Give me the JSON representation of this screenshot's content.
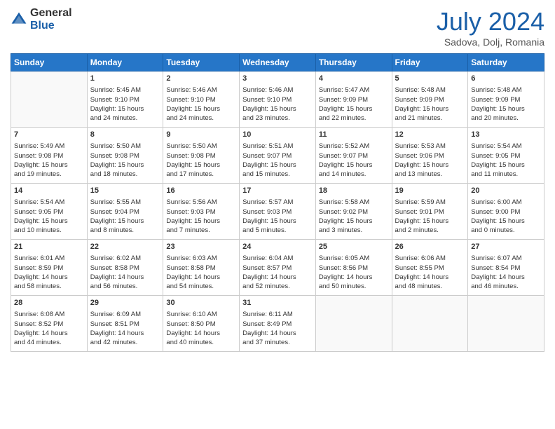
{
  "logo": {
    "general": "General",
    "blue": "Blue"
  },
  "title": "July 2024",
  "subtitle": "Sadova, Dolj, Romania",
  "days_header": [
    "Sunday",
    "Monday",
    "Tuesday",
    "Wednesday",
    "Thursday",
    "Friday",
    "Saturday"
  ],
  "weeks": [
    [
      {
        "day": "",
        "content": ""
      },
      {
        "day": "1",
        "content": "Sunrise: 5:45 AM\nSunset: 9:10 PM\nDaylight: 15 hours\nand 24 minutes."
      },
      {
        "day": "2",
        "content": "Sunrise: 5:46 AM\nSunset: 9:10 PM\nDaylight: 15 hours\nand 24 minutes."
      },
      {
        "day": "3",
        "content": "Sunrise: 5:46 AM\nSunset: 9:10 PM\nDaylight: 15 hours\nand 23 minutes."
      },
      {
        "day": "4",
        "content": "Sunrise: 5:47 AM\nSunset: 9:09 PM\nDaylight: 15 hours\nand 22 minutes."
      },
      {
        "day": "5",
        "content": "Sunrise: 5:48 AM\nSunset: 9:09 PM\nDaylight: 15 hours\nand 21 minutes."
      },
      {
        "day": "6",
        "content": "Sunrise: 5:48 AM\nSunset: 9:09 PM\nDaylight: 15 hours\nand 20 minutes."
      }
    ],
    [
      {
        "day": "7",
        "content": "Sunrise: 5:49 AM\nSunset: 9:08 PM\nDaylight: 15 hours\nand 19 minutes."
      },
      {
        "day": "8",
        "content": "Sunrise: 5:50 AM\nSunset: 9:08 PM\nDaylight: 15 hours\nand 18 minutes."
      },
      {
        "day": "9",
        "content": "Sunrise: 5:50 AM\nSunset: 9:08 PM\nDaylight: 15 hours\nand 17 minutes."
      },
      {
        "day": "10",
        "content": "Sunrise: 5:51 AM\nSunset: 9:07 PM\nDaylight: 15 hours\nand 15 minutes."
      },
      {
        "day": "11",
        "content": "Sunrise: 5:52 AM\nSunset: 9:07 PM\nDaylight: 15 hours\nand 14 minutes."
      },
      {
        "day": "12",
        "content": "Sunrise: 5:53 AM\nSunset: 9:06 PM\nDaylight: 15 hours\nand 13 minutes."
      },
      {
        "day": "13",
        "content": "Sunrise: 5:54 AM\nSunset: 9:05 PM\nDaylight: 15 hours\nand 11 minutes."
      }
    ],
    [
      {
        "day": "14",
        "content": "Sunrise: 5:54 AM\nSunset: 9:05 PM\nDaylight: 15 hours\nand 10 minutes."
      },
      {
        "day": "15",
        "content": "Sunrise: 5:55 AM\nSunset: 9:04 PM\nDaylight: 15 hours\nand 8 minutes."
      },
      {
        "day": "16",
        "content": "Sunrise: 5:56 AM\nSunset: 9:03 PM\nDaylight: 15 hours\nand 7 minutes."
      },
      {
        "day": "17",
        "content": "Sunrise: 5:57 AM\nSunset: 9:03 PM\nDaylight: 15 hours\nand 5 minutes."
      },
      {
        "day": "18",
        "content": "Sunrise: 5:58 AM\nSunset: 9:02 PM\nDaylight: 15 hours\nand 3 minutes."
      },
      {
        "day": "19",
        "content": "Sunrise: 5:59 AM\nSunset: 9:01 PM\nDaylight: 15 hours\nand 2 minutes."
      },
      {
        "day": "20",
        "content": "Sunrise: 6:00 AM\nSunset: 9:00 PM\nDaylight: 15 hours\nand 0 minutes."
      }
    ],
    [
      {
        "day": "21",
        "content": "Sunrise: 6:01 AM\nSunset: 8:59 PM\nDaylight: 14 hours\nand 58 minutes."
      },
      {
        "day": "22",
        "content": "Sunrise: 6:02 AM\nSunset: 8:58 PM\nDaylight: 14 hours\nand 56 minutes."
      },
      {
        "day": "23",
        "content": "Sunrise: 6:03 AM\nSunset: 8:58 PM\nDaylight: 14 hours\nand 54 minutes."
      },
      {
        "day": "24",
        "content": "Sunrise: 6:04 AM\nSunset: 8:57 PM\nDaylight: 14 hours\nand 52 minutes."
      },
      {
        "day": "25",
        "content": "Sunrise: 6:05 AM\nSunset: 8:56 PM\nDaylight: 14 hours\nand 50 minutes."
      },
      {
        "day": "26",
        "content": "Sunrise: 6:06 AM\nSunset: 8:55 PM\nDaylight: 14 hours\nand 48 minutes."
      },
      {
        "day": "27",
        "content": "Sunrise: 6:07 AM\nSunset: 8:54 PM\nDaylight: 14 hours\nand 46 minutes."
      }
    ],
    [
      {
        "day": "28",
        "content": "Sunrise: 6:08 AM\nSunset: 8:52 PM\nDaylight: 14 hours\nand 44 minutes."
      },
      {
        "day": "29",
        "content": "Sunrise: 6:09 AM\nSunset: 8:51 PM\nDaylight: 14 hours\nand 42 minutes."
      },
      {
        "day": "30",
        "content": "Sunrise: 6:10 AM\nSunset: 8:50 PM\nDaylight: 14 hours\nand 40 minutes."
      },
      {
        "day": "31",
        "content": "Sunrise: 6:11 AM\nSunset: 8:49 PM\nDaylight: 14 hours\nand 37 minutes."
      },
      {
        "day": "",
        "content": ""
      },
      {
        "day": "",
        "content": ""
      },
      {
        "day": "",
        "content": ""
      }
    ]
  ]
}
